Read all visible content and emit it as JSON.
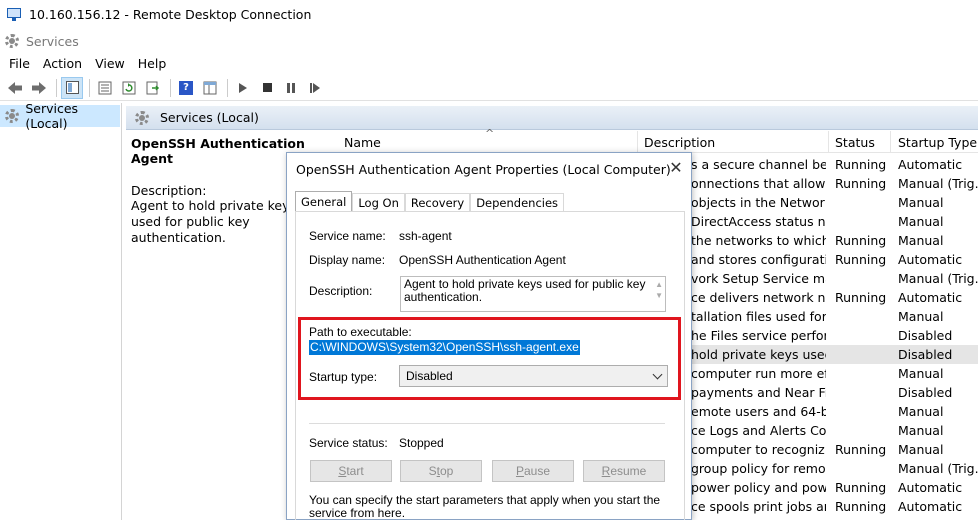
{
  "rdp": {
    "title": "10.160.156.12 - Remote Desktop Connection",
    "icon": "monitor-icon"
  },
  "app": {
    "title": "Services",
    "icon": "gear-icon"
  },
  "menu": {
    "items": [
      "File",
      "Action",
      "View",
      "Help"
    ]
  },
  "toolbar": {
    "icons": [
      "back-icon",
      "forward-icon",
      "console-tree-icon",
      "properties-icon",
      "refresh-icon",
      "export-icon",
      "help-icon",
      "details-icon",
      "start-icon",
      "stop-icon",
      "pause-icon",
      "resume-icon"
    ],
    "help_glyph": "?"
  },
  "tree": {
    "root": "Services (Local)"
  },
  "pane": {
    "header": "Services (Local)",
    "selected_name": "OpenSSH Authentication Agent",
    "description_label": "Description:",
    "description": "Agent to hold private keys used for public key authentication."
  },
  "list": {
    "columns": {
      "name": "Name",
      "description": "Description",
      "status": "Status",
      "startup": "Startup Type"
    },
    "sort_glyph": "^",
    "rows": [
      {
        "desc": "s a secure channel bet...",
        "status": "Running",
        "type": "Automatic"
      },
      {
        "desc": "onnections that allow ...",
        "status": "Running",
        "type": "Manual (Trig..."
      },
      {
        "desc": "objects in the Network...",
        "status": "",
        "type": "Manual"
      },
      {
        "desc": "DirectAccess status not...",
        "status": "",
        "type": "Manual"
      },
      {
        "desc": "the networks to which...",
        "status": "Running",
        "type": "Manual"
      },
      {
        "desc": "and stores configurati...",
        "status": "Running",
        "type": "Automatic"
      },
      {
        "desc": "vork Setup Service man...",
        "status": "",
        "type": "Manual (Trig..."
      },
      {
        "desc": "ce delivers network not...",
        "status": "Running",
        "type": "Automatic"
      },
      {
        "desc": "tallation files used for u...",
        "status": "",
        "type": "Manual"
      },
      {
        "desc": "he Files service perform...",
        "status": "",
        "type": "Disabled"
      },
      {
        "desc": "hold private keys used ...",
        "status": "",
        "type": "Disabled"
      },
      {
        "desc": "computer run more ef...",
        "status": "",
        "type": "Manual"
      },
      {
        "desc": "payments and Near Fi...",
        "status": "",
        "type": "Disabled"
      },
      {
        "desc": "emote users and 64-bit...",
        "status": "",
        "type": "Manual"
      },
      {
        "desc": "ce Logs and Alerts Co...",
        "status": "",
        "type": "Manual"
      },
      {
        "desc": "computer to recogniz...",
        "status": "Running",
        "type": "Manual"
      },
      {
        "desc": "group policy for remov...",
        "status": "",
        "type": "Manual (Trig..."
      },
      {
        "desc": "power policy and pow...",
        "status": "Running",
        "type": "Automatic"
      },
      {
        "desc": "ce spools print jobs an...",
        "status": "Running",
        "type": "Automatic"
      }
    ]
  },
  "dialog": {
    "title": "OpenSSH Authentication Agent Properties (Local Computer)",
    "close_glyph": "✕",
    "tabs": [
      "General",
      "Log On",
      "Recovery",
      "Dependencies"
    ],
    "service_name_label": "Service name:",
    "service_name": "ssh-agent",
    "display_name_label": "Display name:",
    "display_name": "OpenSSH Authentication Agent",
    "description_label": "Description:",
    "description": "Agent to hold private keys used for public key authentication.",
    "path_label": "Path to executable:",
    "path": "C:\\WINDOWS\\System32\\OpenSSH\\ssh-agent.exe",
    "startup_label": "Startup type:",
    "startup_value": "Disabled",
    "status_label": "Service status:",
    "status_value": "Stopped",
    "buttons": {
      "start": {
        "mn": "S",
        "rest": "tart"
      },
      "stop": {
        "mn": "S",
        "rest": "top",
        "pre": ""
      },
      "pause": {
        "pre": "",
        "mn": "P",
        "rest": "ause"
      },
      "resume": {
        "mn": "R",
        "rest": "esume"
      }
    },
    "footnote": "You can specify the start parameters that apply when you start the service from here."
  },
  "colors": {
    "highlight": "#e0151e",
    "selection": "#0078d7",
    "tree_selected": "#cce8ff"
  }
}
